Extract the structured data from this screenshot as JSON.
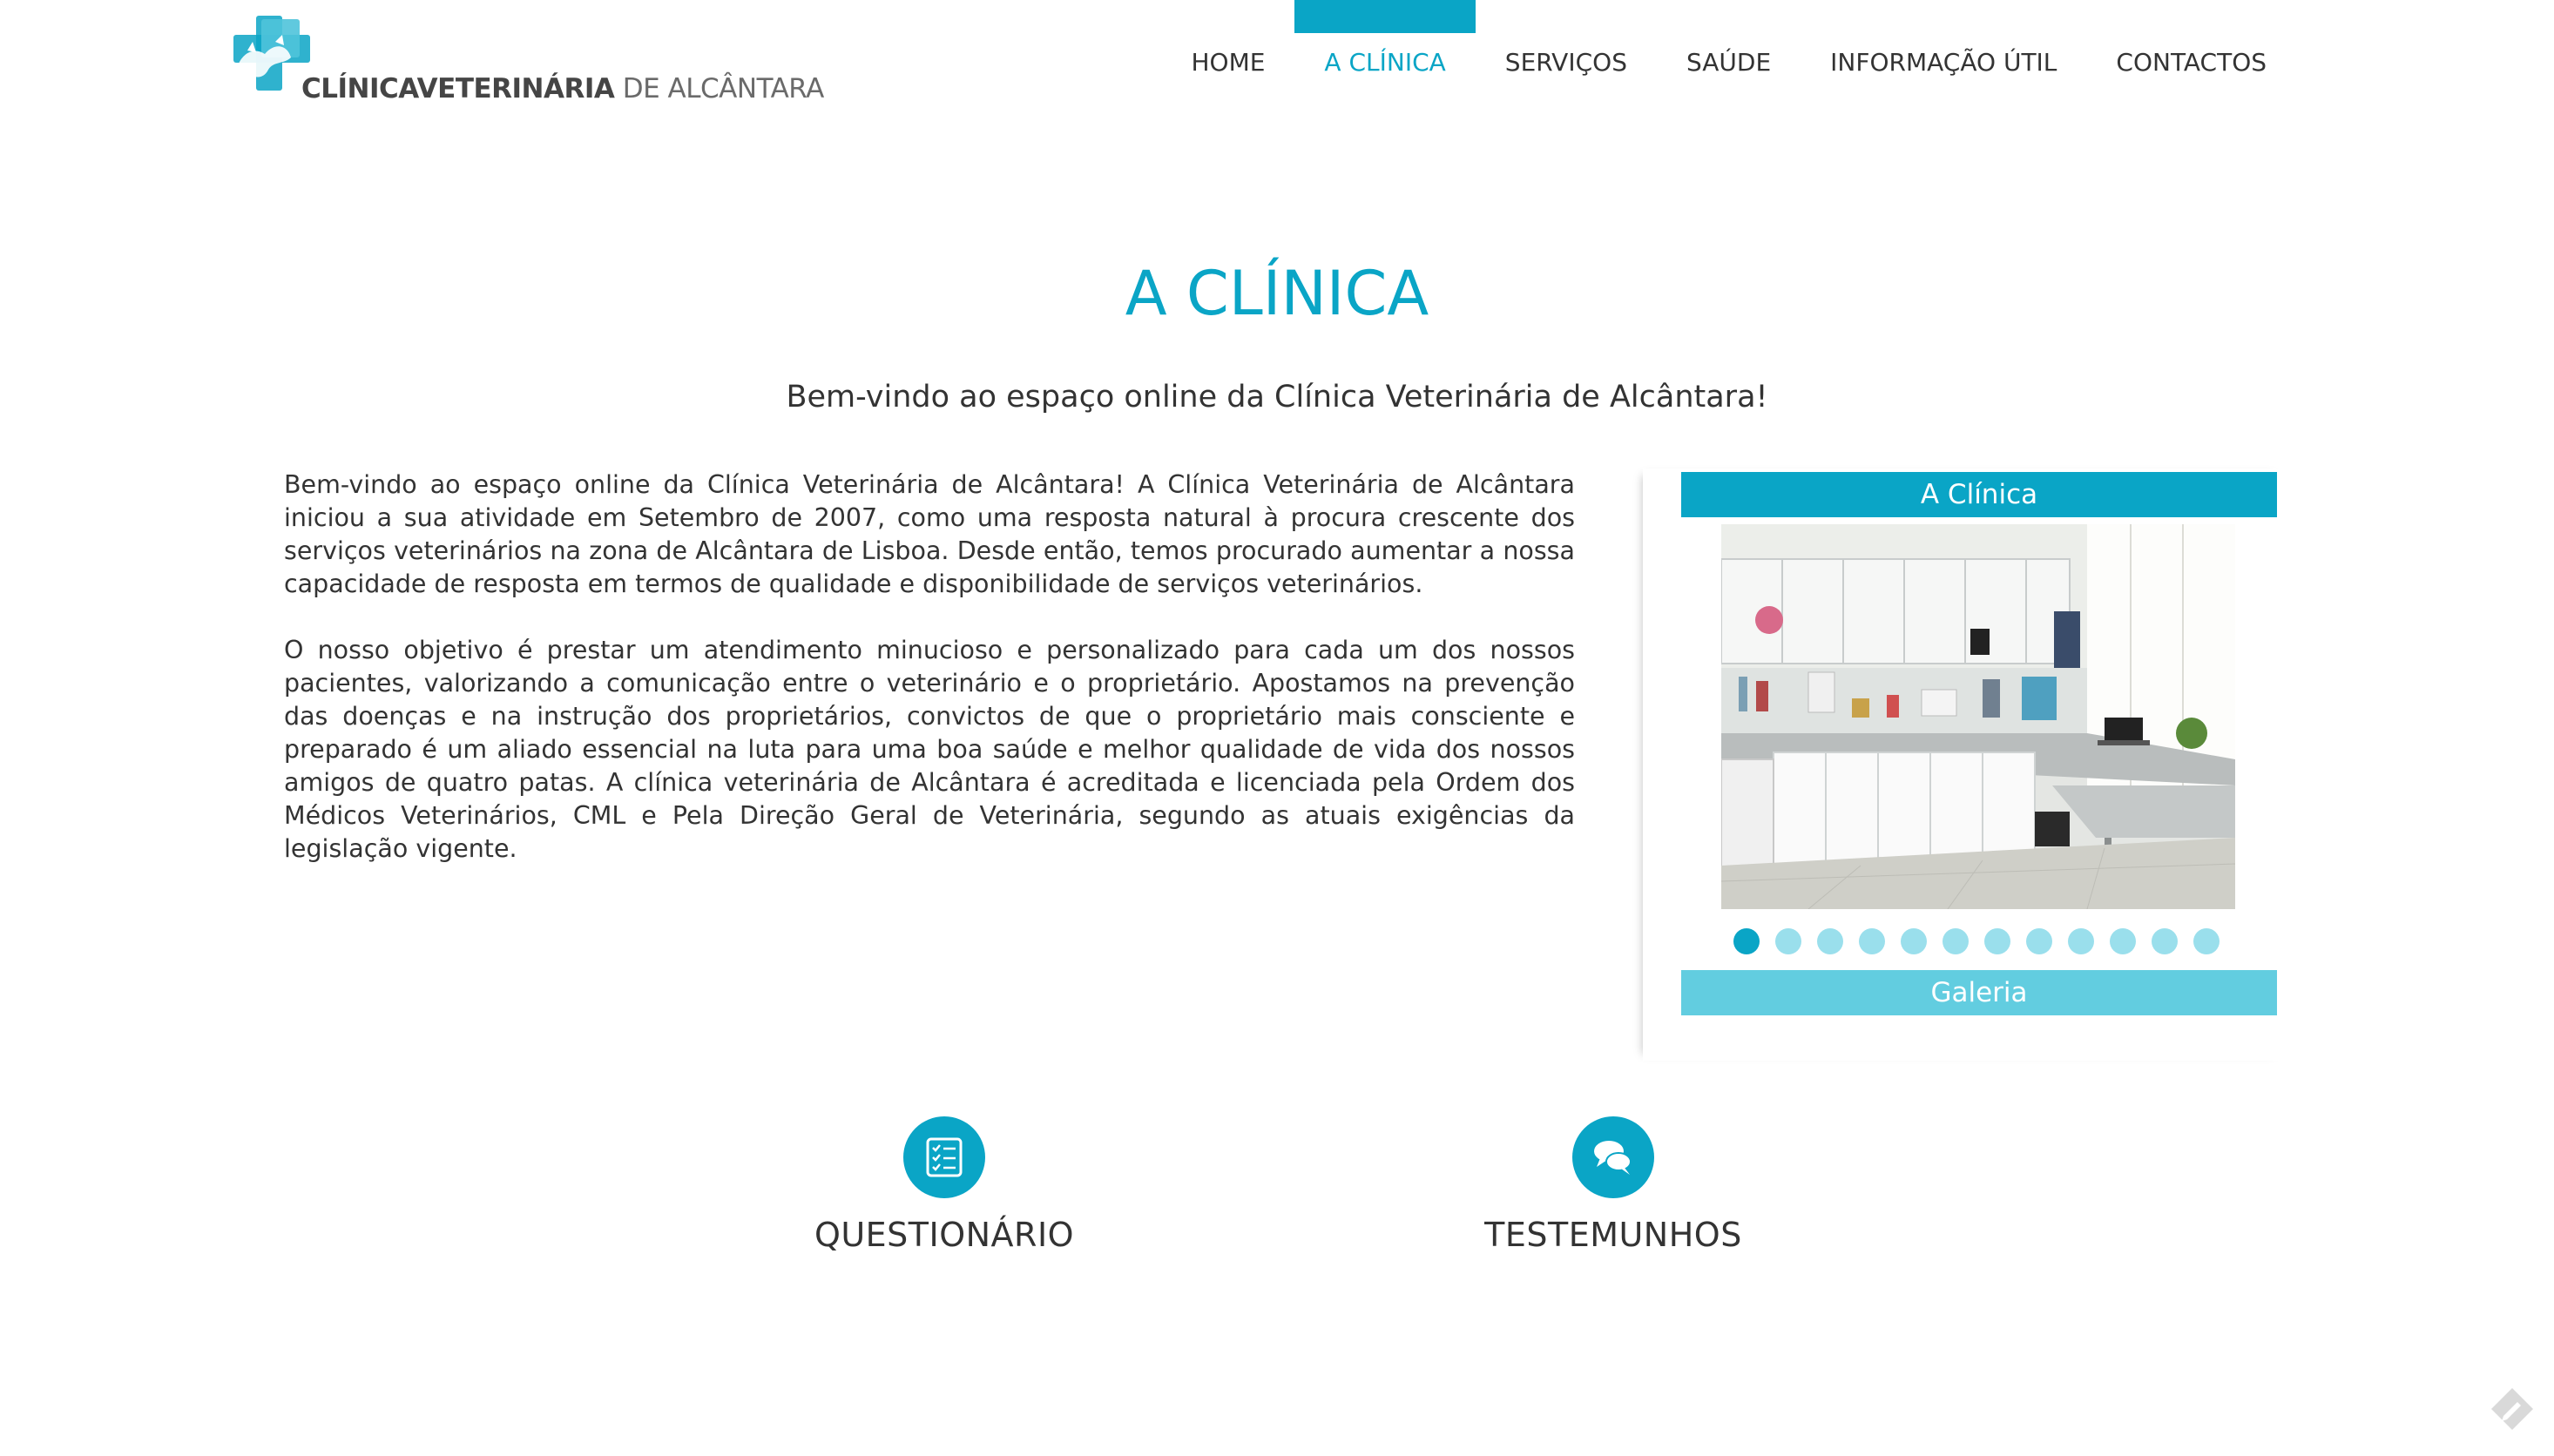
{
  "brand": {
    "name_bold": "CLÍNICAVETERINÁRIA",
    "name_light": " DE ALCÂNTARA",
    "accent_color": "#0aa5c6",
    "accent_light_color": "#62cde0",
    "dot_inactive_color": "#9adfec"
  },
  "nav": {
    "items": [
      {
        "label": "HOME"
      },
      {
        "label": "A CLÍNICA",
        "active": true
      },
      {
        "label": "SERVIÇOS"
      },
      {
        "label": "SAÚDE"
      },
      {
        "label": "INFORMAÇÃO ÚTIL"
      },
      {
        "label": "CONTACTOS"
      }
    ]
  },
  "page": {
    "title": "A CLÍNICA",
    "subtitle": "Bem-vindo ao espaço online da Clínica Veterinária de Alcântara!",
    "paragraphs": [
      "Bem-vindo ao espaço online da Clínica Veterinária de Alcântara! A Clínica Veterinária de Alcântara iniciou a sua atividade em Setembro de 2007, como uma resposta natural à procura crescente dos serviços veterinários na zona de Alcântara de Lisboa. Desde então, temos procurado aumentar a nossa capacidade de resposta em termos de qualidade e disponibilidade de serviços veterinários.",
      "O nosso objetivo é prestar um atendimento minucioso e personalizado para cada um dos nossos pacientes, valorizando a comunicação entre o veterinário e o proprietário. Apostamos na prevenção das doenças e na instrução dos proprietários, convictos de que o proprietário mais consciente e preparado é um aliado essencial na luta para uma boa saúde e melhor qualidade de vida dos nossos amigos de quatro patas. A clínica veterinária de Alcântara é acreditada e licenciada pela Ordem dos Médicos Veterinários, CML e Pela Direção Geral de Veterinária, segundo as atuais exigências da legislação vigente."
    ]
  },
  "gallery": {
    "header": "A Clínica",
    "footer": "Galeria",
    "slide_count": 12,
    "active_slide": 1
  },
  "features": {
    "questionario": {
      "label": "QUESTIONÁRIO",
      "icon": "checklist-icon"
    },
    "testemunhos": {
      "label": "TESTEMUNHOS",
      "icon": "chat-bubbles-icon"
    }
  },
  "corner": {
    "icon": "pencil-icon"
  }
}
